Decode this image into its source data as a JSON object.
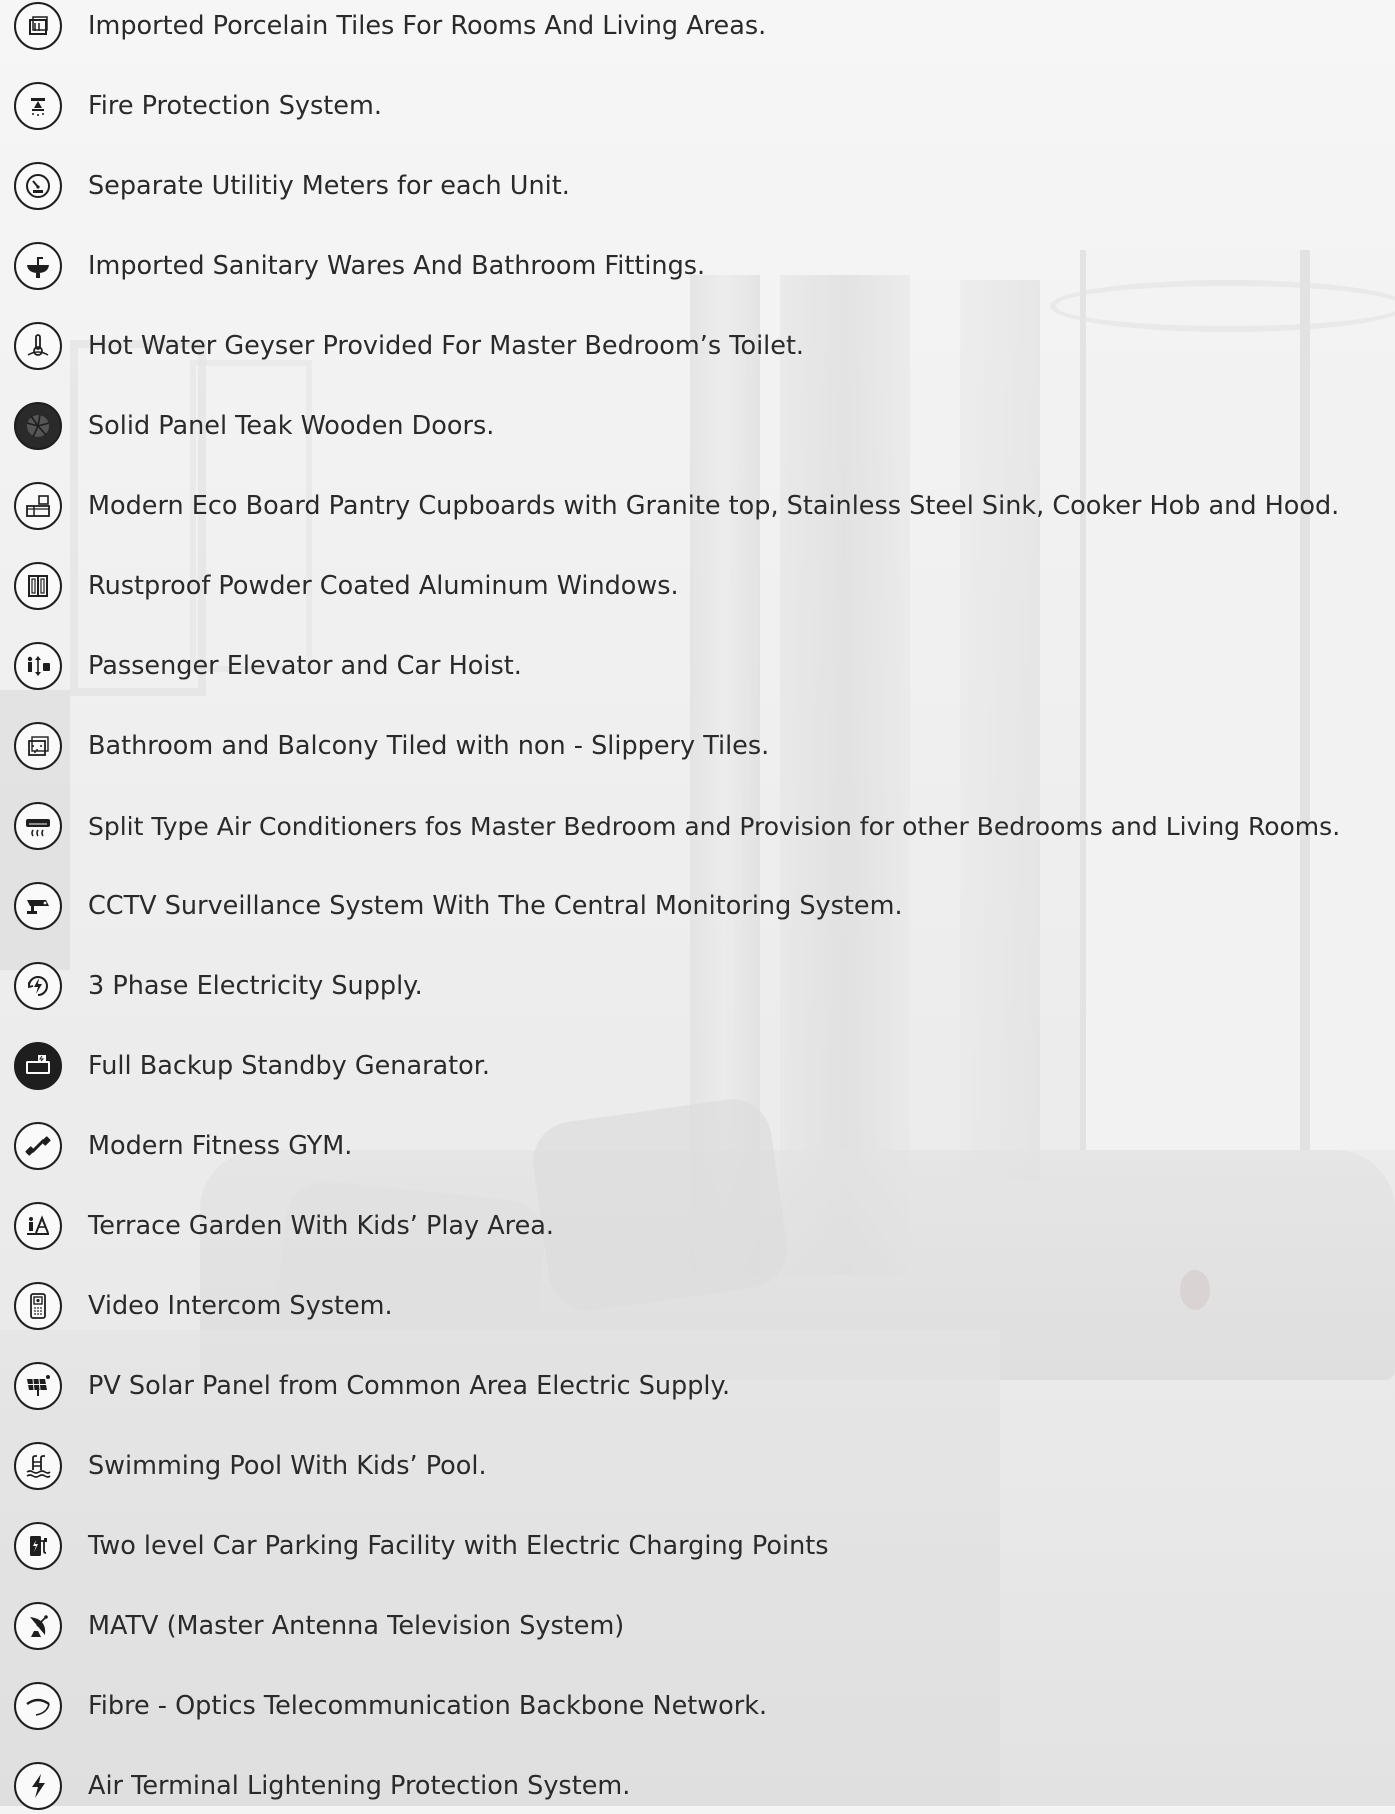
{
  "features": [
    {
      "icon": "tiles-icon",
      "label": "Imported Porcelain Tiles For Rooms And Living Areas."
    },
    {
      "icon": "fire-sprinkler-icon",
      "label": "Fire Protection System."
    },
    {
      "icon": "meter-gauge-icon",
      "label": "Separate Utilitiy Meters for each Unit."
    },
    {
      "icon": "sink-faucet-icon",
      "label": "Imported Sanitary Wares And Bathroom Fittings."
    },
    {
      "icon": "geyser-icon",
      "label": "Hot Water Geyser Provided For Master Bedroom’s Toilet."
    },
    {
      "icon": "wooden-door-icon",
      "label": "Solid Panel Teak Wooden Doors."
    },
    {
      "icon": "pantry-cupboard-icon",
      "label": "Modern Eco Board Pantry Cupboards with Granite top, Stainless Steel Sink, Cooker Hob and Hood."
    },
    {
      "icon": "window-icon",
      "label": "Rustproof Powder Coated Aluminum Windows."
    },
    {
      "icon": "elevator-icon",
      "label": "Passenger Elevator and Car Hoist."
    },
    {
      "icon": "non-slip-tiles-icon",
      "label": "Bathroom and Balcony Tiled with non - Slippery Tiles."
    },
    {
      "icon": "air-conditioner-icon",
      "label": "Split Type Air Conditioners fos Master Bedroom and Provision for other Bedrooms and Living Rooms."
    },
    {
      "icon": "cctv-camera-icon",
      "label": "CCTV Surveillance System With The Central Monitoring System."
    },
    {
      "icon": "three-phase-power-icon",
      "label": "3 Phase Electricity Supply."
    },
    {
      "icon": "generator-icon",
      "label": "Full Backup Standby Genarator."
    },
    {
      "icon": "dumbbell-icon",
      "label": "Modern Fitness GYM."
    },
    {
      "icon": "playground-icon",
      "label": "Terrace Garden With Kids’ Play Area."
    },
    {
      "icon": "intercom-icon",
      "label": "Video Intercom System."
    },
    {
      "icon": "solar-panel-icon",
      "label": "PV Solar Panel from Common Area Electric Supply."
    },
    {
      "icon": "swimming-pool-icon",
      "label": "Swimming Pool With Kids’ Pool."
    },
    {
      "icon": "ev-charging-icon",
      "label": "Two level Car Parking Facility with Electric Charging Points"
    },
    {
      "icon": "satellite-antenna-icon",
      "label": "MATV (Master Antenna Television System)"
    },
    {
      "icon": "fibre-optic-icon",
      "label": "Fibre - Optics Telecommunication Backbone Network."
    },
    {
      "icon": "lightning-bolt-icon",
      "label": "Air Terminal Lightening Protection System."
    }
  ]
}
